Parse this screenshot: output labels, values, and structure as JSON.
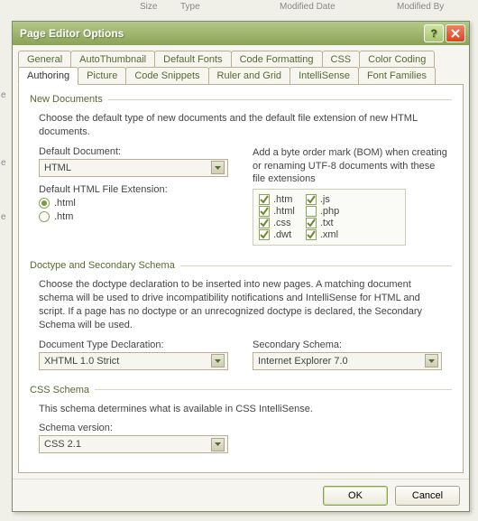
{
  "bg": {
    "size": "Size",
    "type": "Type",
    "moddate": "Modified Date",
    "modby": "Modified By",
    "e": "e"
  },
  "title": "Page Editor Options",
  "tabs_top": [
    "General",
    "AutoThumbnail",
    "Default Fonts",
    "Code Formatting",
    "CSS",
    "Color Coding"
  ],
  "tabs_bottom": [
    "Authoring",
    "Picture",
    "Code Snippets",
    "Ruler and Grid",
    "IntelliSense",
    "Font Families"
  ],
  "newdocs": {
    "title": "New Documents",
    "desc": "Choose the default type of new documents and the default file extension of new HTML documents.",
    "defdoc_label": "Default Document:",
    "defdoc_value": "HTML",
    "ext_label": "Default HTML File Extension:",
    "radio_html": ".html",
    "radio_htm": ".htm",
    "bom_label": "Add a byte order mark (BOM) when creating or renaming UTF-8 documents with these file extensions",
    "exts_left": [
      {
        "label": ".htm",
        "checked": true
      },
      {
        "label": ".html",
        "checked": true
      },
      {
        "label": ".css",
        "checked": true
      },
      {
        "label": ".dwt",
        "checked": true
      }
    ],
    "exts_right": [
      {
        "label": ".js",
        "checked": true
      },
      {
        "label": ".php",
        "checked": false
      },
      {
        "label": ".txt",
        "checked": true
      },
      {
        "label": ".xml",
        "checked": true
      }
    ]
  },
  "doctype": {
    "title": "Doctype and Secondary Schema",
    "desc": "Choose the doctype declaration to be inserted into new pages. A matching document schema will be used to drive incompatibility notifications and IntelliSense for HTML and script. If a page has no doctype or an unrecognized doctype is declared, the Secondary Schema will be used.",
    "dtd_label": "Document Type Declaration:",
    "dtd_value": "XHTML 1.0 Strict",
    "sec_label": "Secondary Schema:",
    "sec_value": "Internet Explorer 7.0"
  },
  "css": {
    "title": "CSS Schema",
    "desc": "This schema determines what is available in CSS IntelliSense.",
    "ver_label": "Schema version:",
    "ver_value": "CSS 2.1"
  },
  "buttons": {
    "ok": "OK",
    "cancel": "Cancel"
  }
}
